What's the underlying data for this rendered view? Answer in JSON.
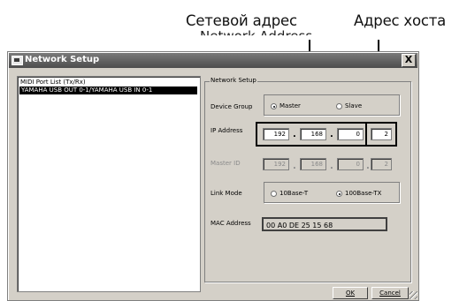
{
  "annotations": {
    "network_address": "Сетевой адрес",
    "network_address_en": "Network Address",
    "host_address": "Адрес хоста"
  },
  "window": {
    "title": "Network Setup",
    "close_label": "X"
  },
  "midi_port_list": {
    "header": "MIDI Port List (Tx/Rx)",
    "items": [
      "YAMAHA USB OUT 0-1/YAMAHA USB IN 0-1"
    ]
  },
  "network_setup": {
    "group_label": "Network Setup",
    "device_group": {
      "label": "Device Group",
      "options": [
        "Master",
        "Slave"
      ],
      "selected": "Master"
    },
    "ip_address": {
      "label": "IP Address",
      "octets": [
        "192",
        "168",
        "0",
        "2"
      ]
    },
    "master_id": {
      "label": "Master ID",
      "octets": [
        "192",
        "168",
        "0",
        "2"
      ]
    },
    "link_mode": {
      "label": "Link Mode",
      "options": [
        "10Base-T",
        "100Base-TX"
      ],
      "selected": "100Base-TX"
    },
    "mac_address": {
      "label": "MAC Address",
      "value": "00 A0 DE 25 15 68"
    }
  },
  "buttons": {
    "ok": "OK",
    "cancel": "Cancel"
  }
}
